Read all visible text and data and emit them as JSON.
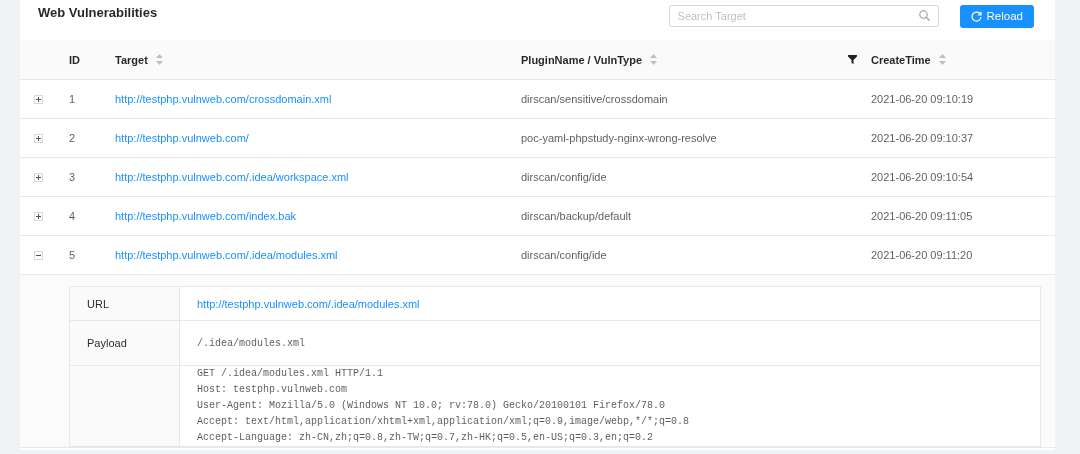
{
  "header": {
    "title": "Web Vulnerabilities",
    "search": {
      "placeholder": "Search Target"
    },
    "reload_button": "Reload"
  },
  "table": {
    "columns": [
      {
        "label": "ID",
        "sortable": false,
        "filter": false
      },
      {
        "label": "Target",
        "sortable": true,
        "filter": false
      },
      {
        "label": "PluginName / VulnType",
        "sortable": true,
        "filter": true
      },
      {
        "label": "CreateTime",
        "sortable": true,
        "filter": false
      }
    ],
    "rows": [
      {
        "expanded": false,
        "id": "1",
        "target": "http://testphp.vulnweb.com/crossdomain.xml",
        "plugin": "dirscan/sensitive/crossdomain",
        "time": "2021-06-20 09:10:19"
      },
      {
        "expanded": false,
        "id": "2",
        "target": "http://testphp.vulnweb.com/",
        "plugin": "poc-yaml-phpstudy-nginx-wrong-resolve",
        "time": "2021-06-20 09:10:37"
      },
      {
        "expanded": false,
        "id": "3",
        "target": "http://testphp.vulnweb.com/.idea/workspace.xml",
        "plugin": "dirscan/config/ide",
        "time": "2021-06-20 09:10:54"
      },
      {
        "expanded": false,
        "id": "4",
        "target": "http://testphp.vulnweb.com/index.bak",
        "plugin": "dirscan/backup/default",
        "time": "2021-06-20 09:11:05"
      },
      {
        "expanded": true,
        "id": "5",
        "target": "http://testphp.vulnweb.com/.idea/modules.xml",
        "plugin": "dirscan/config/ide",
        "time": "2021-06-20 09:11:20"
      }
    ],
    "detail": {
      "url_label": "URL",
      "url": "http://testphp.vulnweb.com/.idea/modules.xml",
      "payload_label": "Payload",
      "payload": "/.idea/modules.xml",
      "request_lines": [
        "GET /.idea/modules.xml HTTP/1.1",
        "Host: testphp.vulnweb.com",
        "User-Agent: Mozilla/5.0 (Windows NT 10.0; rv:78.0) Gecko/20100101 Firefox/78.0",
        "Accept: text/html,application/xhtml+xml,application/xml;q=0.9,image/webp,*/*;q=0.8",
        "Accept-Language: zh-CN,zh;q=0.8,zh-TW;q=0.7,zh-HK;q=0.5,en-US;q=0.3,en;q=0.2"
      ]
    }
  }
}
